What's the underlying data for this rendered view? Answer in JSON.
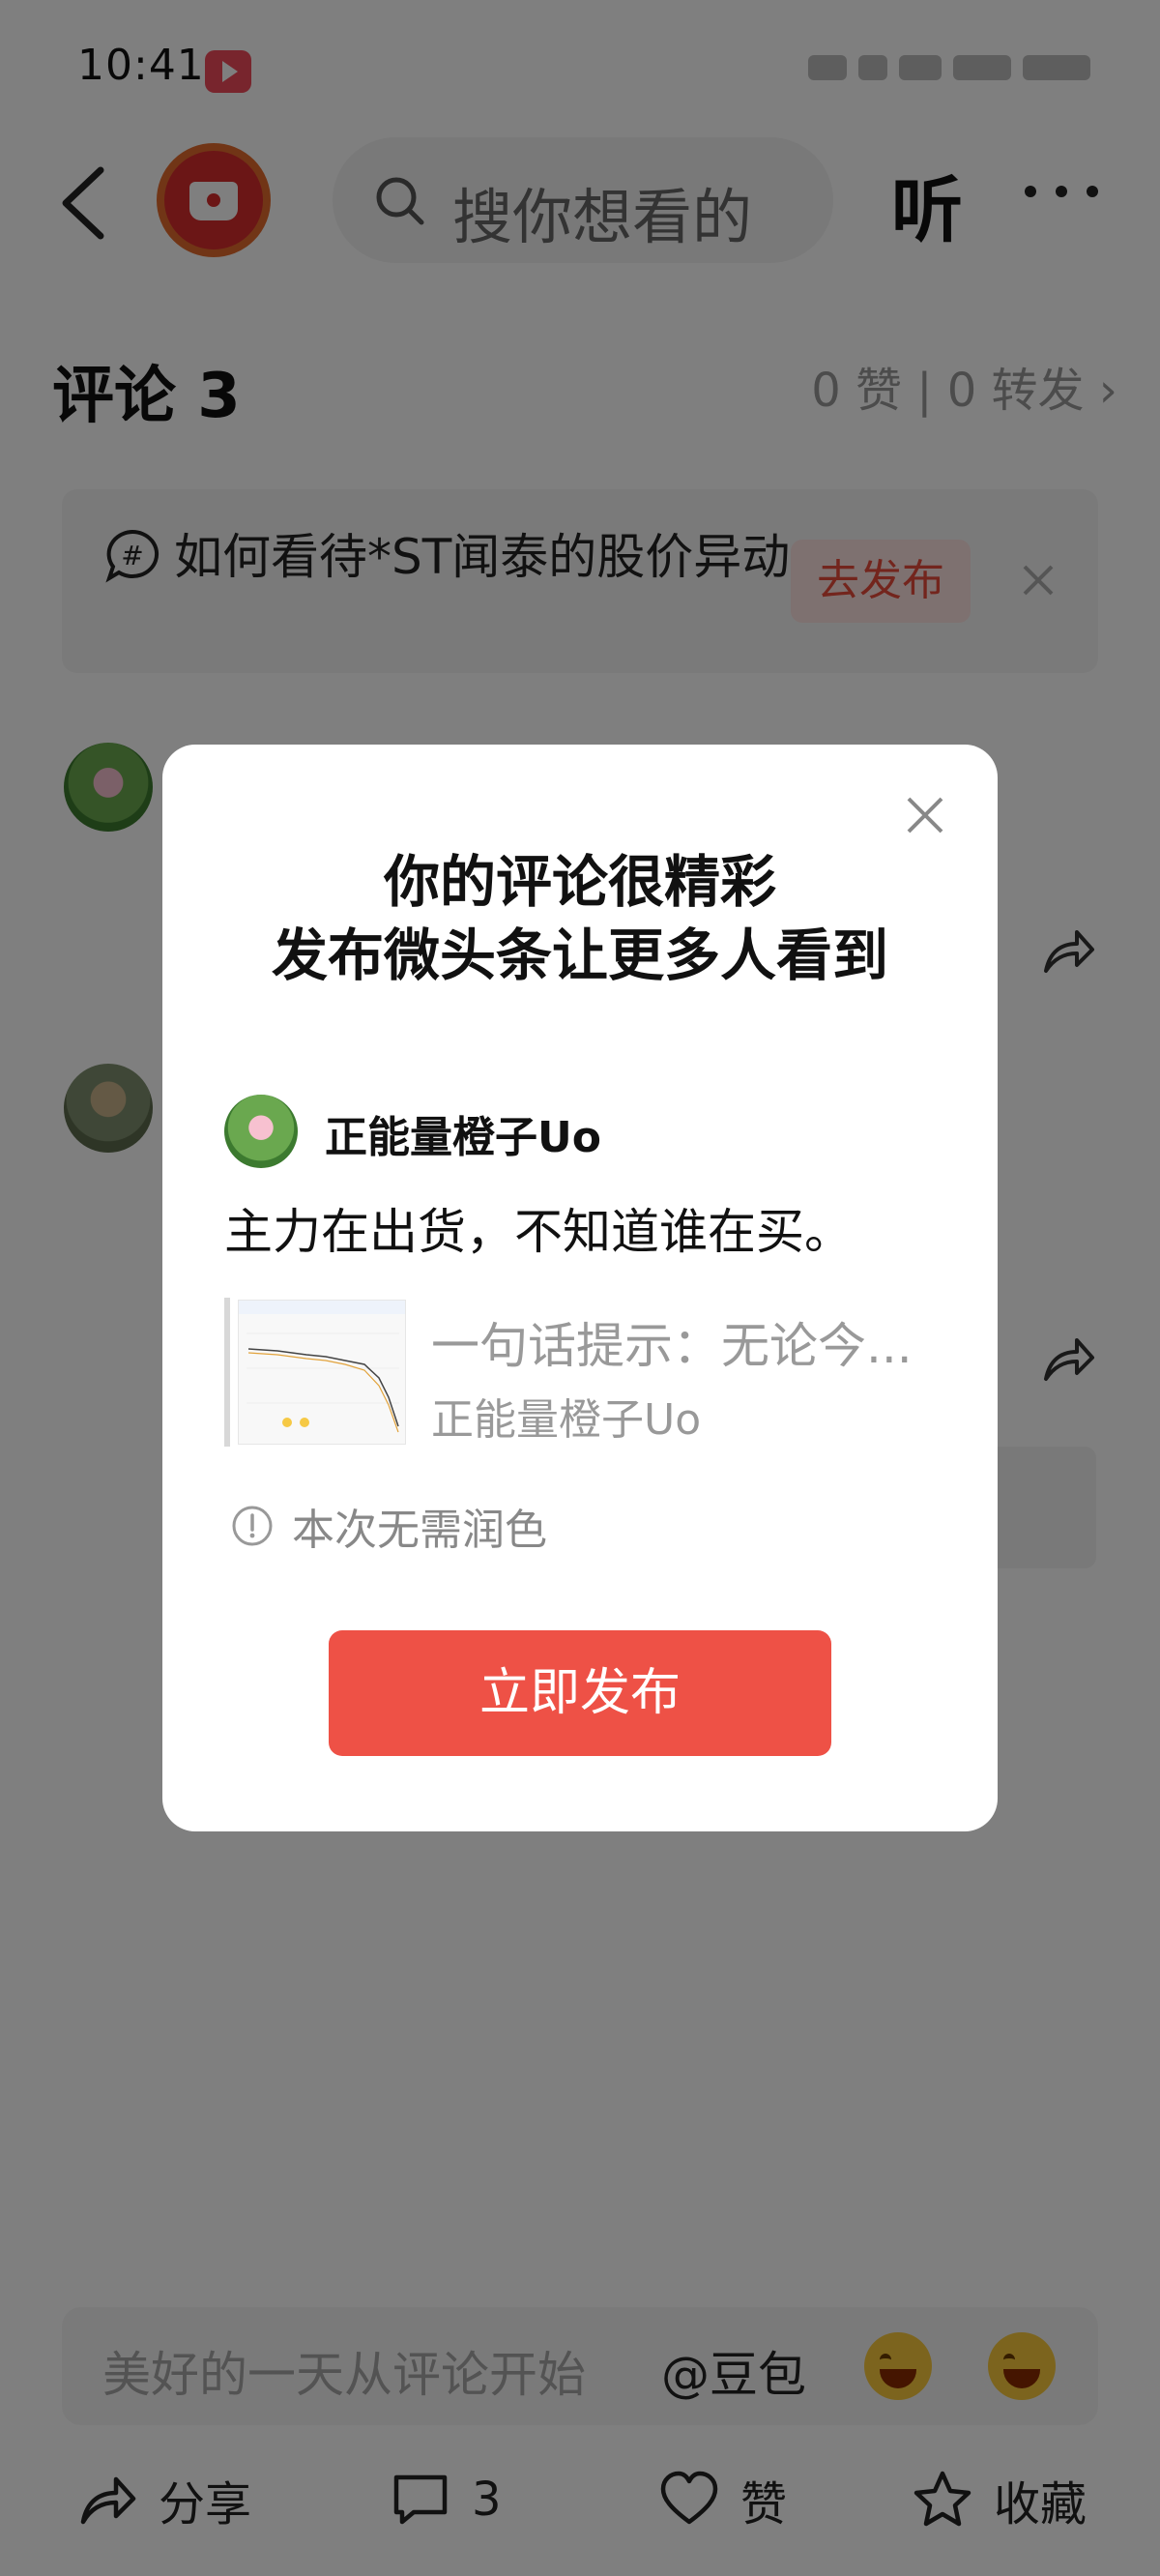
{
  "status_bar": {
    "time": "10:41"
  },
  "header": {
    "search_placeholder": "搜你想看的",
    "listen_label": "听"
  },
  "comments": {
    "title": "评论 3",
    "stats": "0 赞 | 0 转发"
  },
  "topic": {
    "text": "如何看待*ST闻泰的股价异动",
    "publish_label": "去发布"
  },
  "dialog": {
    "title_line1": "你的评论很精彩",
    "title_line2": "发布微头条让更多人看到",
    "preview": {
      "username": "正能量橙子Uo",
      "text": "主力在出货，不知道谁在买。",
      "quote_line1": "一句话提示：无论今...",
      "quote_author": "正能量橙子Uo"
    },
    "notice": "本次无需润色",
    "publish_button": "立即发布"
  },
  "input_bar": {
    "placeholder": "美好的一天从评论开始",
    "mention": "@豆包"
  },
  "bottom_nav": {
    "share": "分享",
    "comments_count": "3",
    "like": "赞",
    "favorite": "收藏"
  },
  "colors": {
    "accent": "#ee5146",
    "overlay": "rgba(0,0,0,0.5)"
  }
}
